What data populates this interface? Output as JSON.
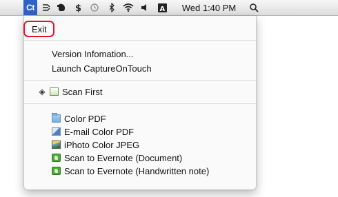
{
  "menubar": {
    "app_icon_label": "Ct",
    "clock": "Wed 1:40 PM",
    "icons": [
      "captureontouch-icon",
      "cursor-tool-icon",
      "evernote-icon",
      "dollar-icon",
      "time-machine-icon",
      "bluetooth-icon",
      "wifi-icon",
      "volume-icon",
      "input-menu-icon",
      "search-icon"
    ]
  },
  "menu": {
    "exit": "Exit",
    "version_info": "Version Infomation...",
    "launch": "Launch CaptureOnTouch",
    "scan_first": "Scan First",
    "jobs": [
      {
        "label": "Color PDF",
        "icon": "folder-icon"
      },
      {
        "label": "E-mail Color PDF",
        "icon": "mail-icon"
      },
      {
        "label": "iPhoto Color JPEG",
        "icon": "iphoto-icon"
      },
      {
        "label": "Scan to Evernote (Document)",
        "icon": "evernote-icon"
      },
      {
        "label": "Scan to Evernote (Handwritten note)",
        "icon": "evernote-icon"
      }
    ]
  },
  "colors": {
    "highlight_ring": "#d8192c",
    "menubar_active": "#2f62c9"
  }
}
